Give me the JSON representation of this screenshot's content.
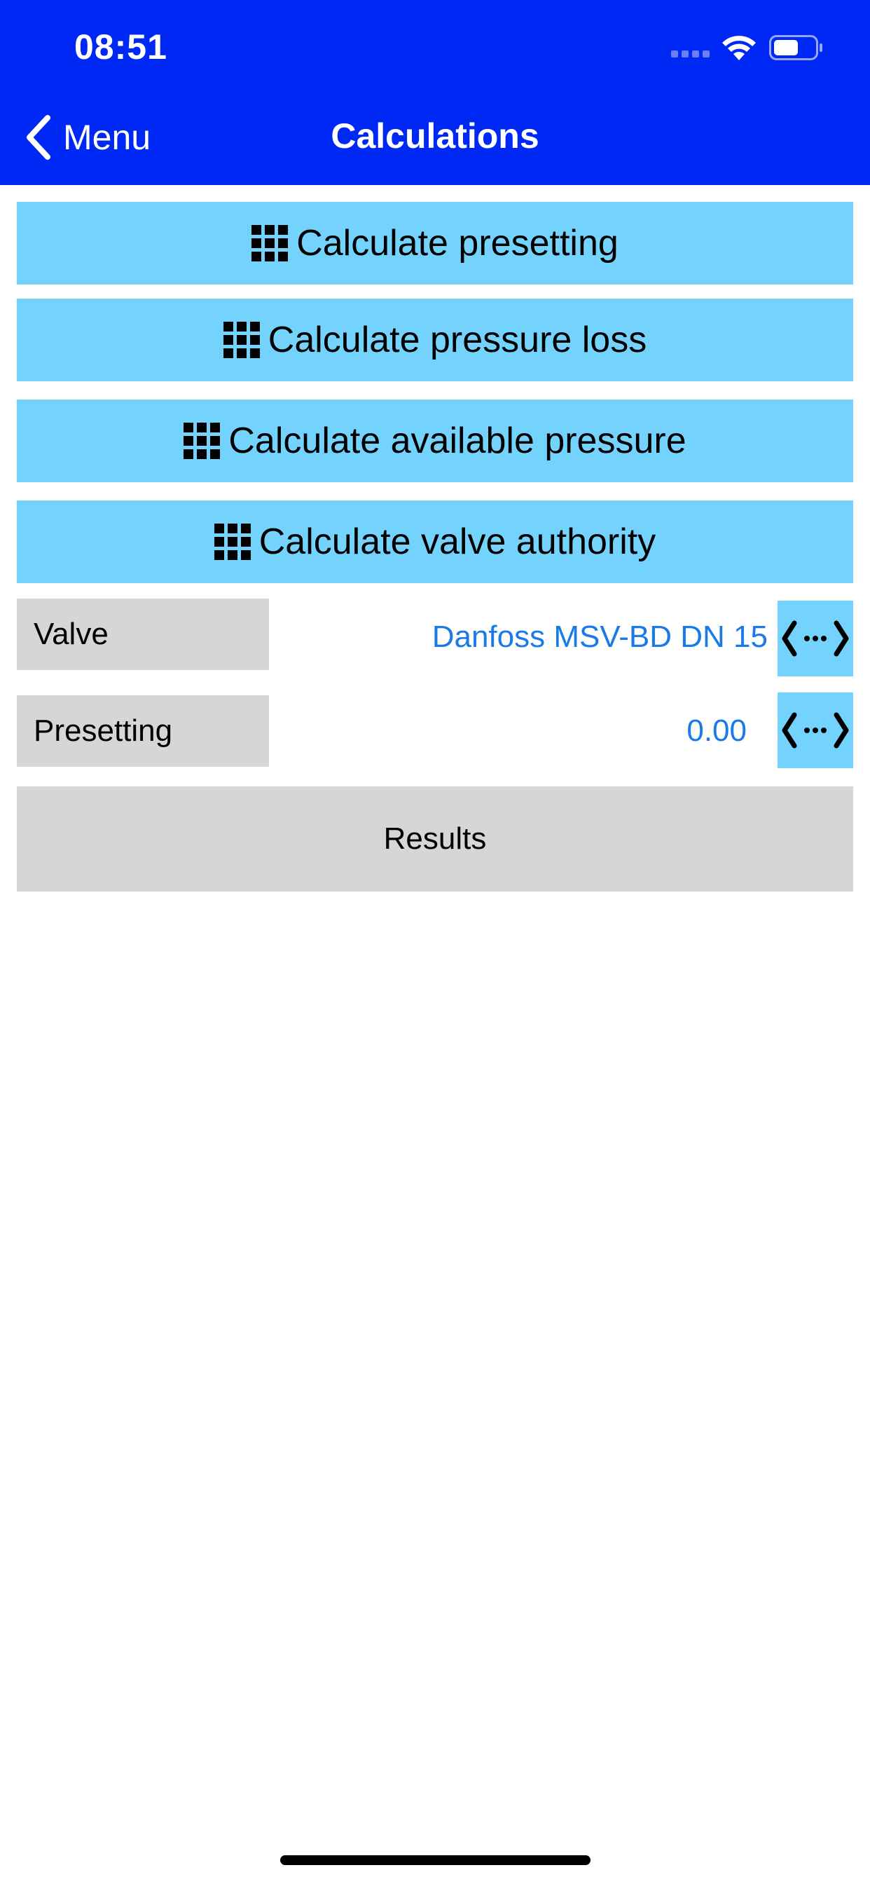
{
  "status_bar": {
    "time": "08:51"
  },
  "nav": {
    "back_label": "Menu",
    "title": "Calculations"
  },
  "calc_buttons": [
    {
      "label": "Calculate presetting",
      "icon": "grid-icon"
    },
    {
      "label": "Calculate pressure loss",
      "icon": "grid-icon"
    },
    {
      "label": "Calculate available pressure",
      "icon": "grid-icon"
    },
    {
      "label": "Calculate valve authority",
      "icon": "grid-icon"
    }
  ],
  "fields": {
    "valve": {
      "label": "Valve",
      "value": "Danfoss MSV-BD DN 15"
    },
    "presetting": {
      "label": "Presetting",
      "value": "0.00"
    }
  },
  "results_label": "Results",
  "colors": {
    "header": "#0028f5",
    "button": "#74d3fd",
    "field_label_bg": "#d6d6d6",
    "value_text": "#1a7ae8"
  }
}
